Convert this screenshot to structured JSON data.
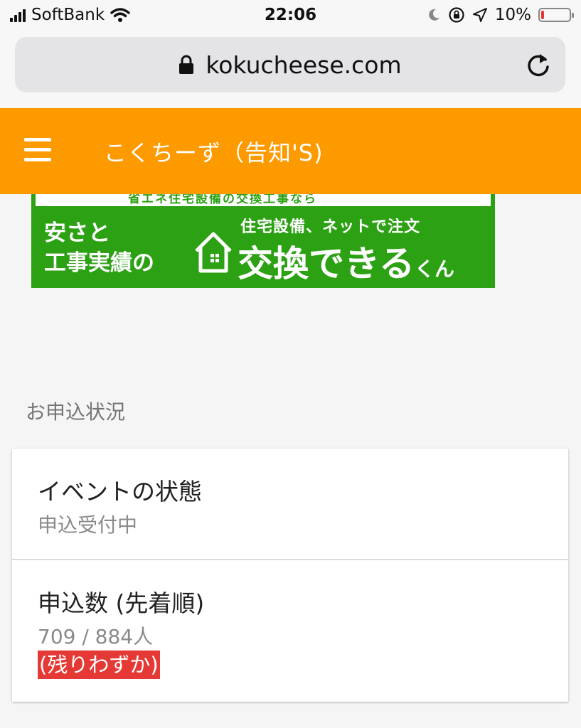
{
  "status_bar": {
    "carrier": "SoftBank",
    "time": "22:06",
    "battery_percent": "10%",
    "battery_level": 0.1
  },
  "browser": {
    "url": "kokucheese.com"
  },
  "header": {
    "title": "こくちーず（告知'S)"
  },
  "ad": {
    "top_strip": "省エネ住宅設備の交換工事なら",
    "left_text": "安さと\n工事実績の",
    "small_text": "住宅設備、ネットで注文",
    "brand_main": "交換できる",
    "brand_suffix": "くん"
  },
  "section": {
    "label": "お申込状況"
  },
  "event_status": {
    "title": "イベントの状態",
    "value": "申込受付中"
  },
  "applications": {
    "title": "申込数 (先着順)",
    "value": "709 / 884人",
    "badge": "(残りわずか)"
  },
  "colors": {
    "header_bg": "#fd9a00",
    "ad_bg": "#2ca113",
    "badge_bg": "#e53935"
  }
}
